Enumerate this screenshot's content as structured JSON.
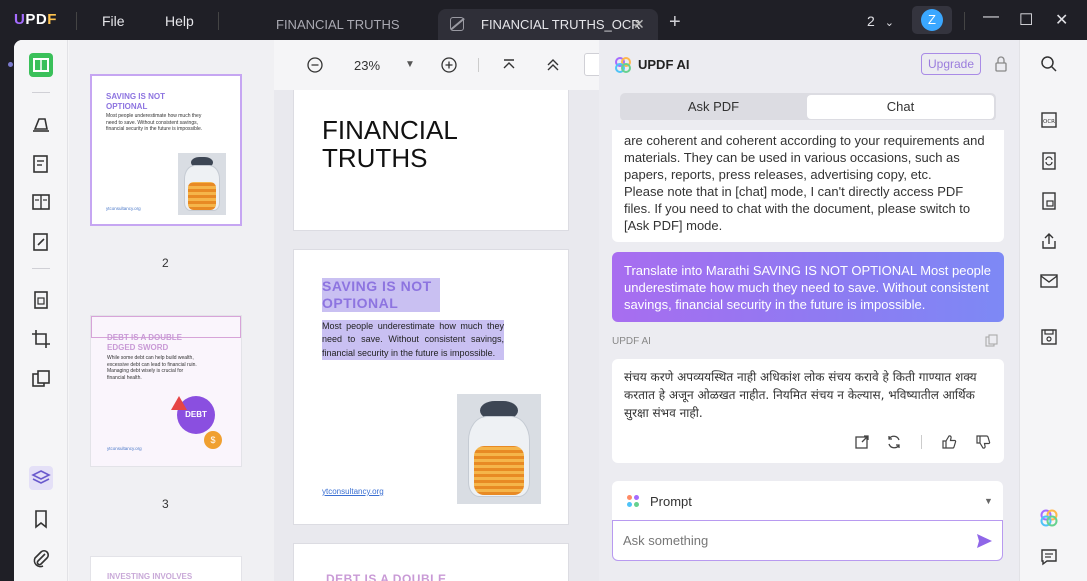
{
  "app": {
    "logo": "UPDF"
  },
  "menu": {
    "file": "File",
    "help": "Help"
  },
  "tabs": [
    {
      "label": "FINANCIAL TRUTHS"
    },
    {
      "label": "FINANCIAL TRUTHS_OCR"
    }
  ],
  "window": {
    "page_count": "2",
    "avatar_initial": "Z"
  },
  "viewer": {
    "zoom": "23%"
  },
  "thumbnails": [
    {
      "number": "2",
      "title": "SAVING IS NOT OPTIONAL",
      "body": "Most people underestimate how much they need to save. Without consistent savings, financial security in the future is impossible.",
      "link": "ytconsultancy.org"
    },
    {
      "number": "3",
      "title": "DEBT IS A DOUBLE EDGED SWORD",
      "body": "While some debt can help build wealth, excessive debt can lead to financial ruin. Managing debt wisely is crucial for financial health.",
      "link": "ytconsultancy.org",
      "badge": "DEBT"
    },
    {
      "title": "INVESTING INVOLVES"
    }
  ],
  "document": {
    "page1_heading_line1": "FINANCIAL",
    "page1_heading_line2": "TRUTHS",
    "page2_title": "SAVING IS NOT OPTIONAL",
    "page2_body": "Most people underestimate how much they need to save. Without consistent savings, financial security in the future is impossible.",
    "page2_link": "ytconsultancy.org",
    "page3_title": "DEBT IS A DOUBLE"
  },
  "ai_panel": {
    "title": "UPDF AI",
    "upgrade": "Upgrade",
    "tabs": {
      "ask_pdf": "Ask PDF",
      "chat": "Chat"
    },
    "messages": {
      "assistant_prev": [
        "are coherent and coherent according to your requirements and materials. They can be used in various occasions, such as papers, reports, press releases, advertising copy, etc.",
        "Please note that in [chat] mode, I can't directly access PDF files. If you need to chat with the document, please switch to [Ask PDF] mode."
      ],
      "user": "Translate into Marathi SAVING IS NOT OPTIONAL Most people underestimate how much they need to save. Without consistent savings, financial security in the future is impossible.",
      "assistant_label": "UPDF AI",
      "assistant_reply": "संचय करणे अपव्ययस्थित नाही अधिकांश लोक संचय करावे हे किती गाण्यात शक्य करतात हे अजून ओळखत नाहीत. नियमित संचय न केल्यास, भविष्यातील आर्थिक सुरक्षा संभव नाही."
    },
    "prompt_label": "Prompt",
    "input_placeholder": "Ask something"
  },
  "colors": {
    "accent": "#a56cff",
    "bubble_gradient_start": "#a86df0",
    "bubble_gradient_end": "#7d89f5",
    "reader_green": "#3ac05a"
  }
}
